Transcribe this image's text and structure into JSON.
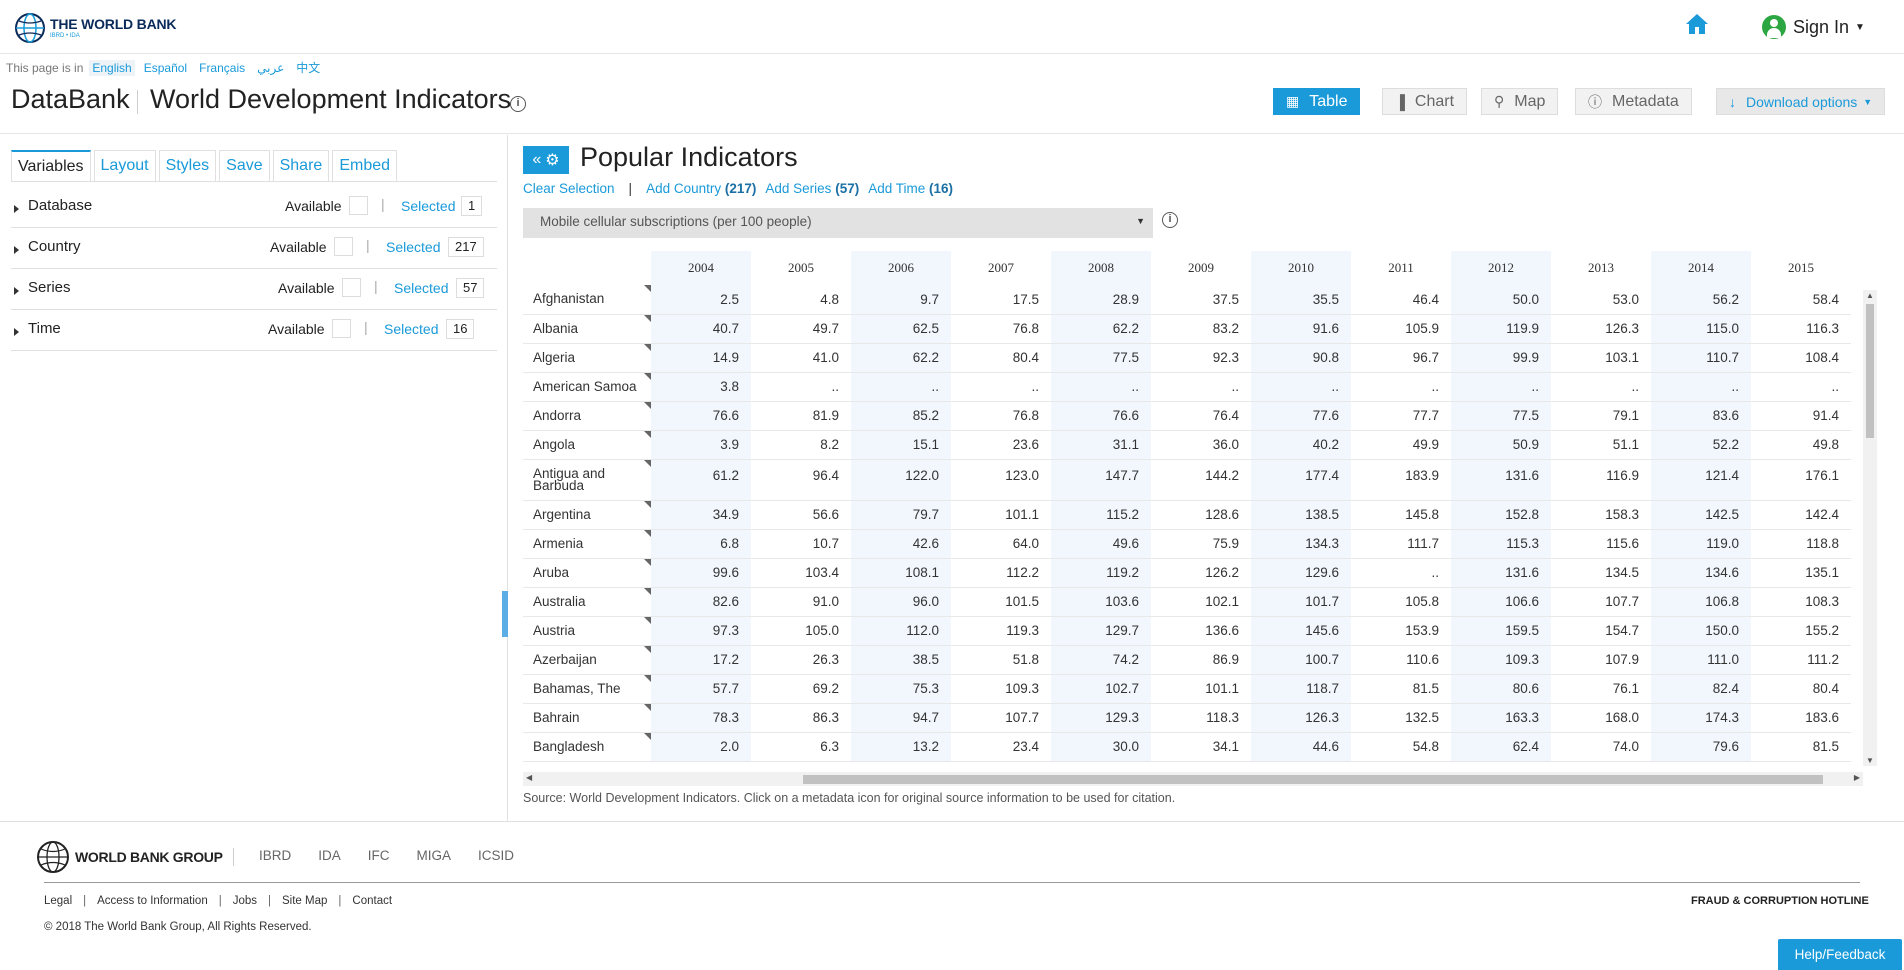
{
  "header": {
    "logo_title": "THE WORLD BANK",
    "logo_sub": "IBRD • IDA",
    "home_icon": "home-icon",
    "signin_label": "Sign In"
  },
  "language": {
    "prefix": "This page is in",
    "options": [
      "English",
      "Español",
      "Français",
      "عربي",
      "中文"
    ],
    "active": "English"
  },
  "title": {
    "app": "DataBank",
    "database": "World Development Indicators"
  },
  "views": {
    "table": "Table",
    "chart": "Chart",
    "map": "Map",
    "metadata": "Metadata",
    "download": "Download options"
  },
  "left_panel": {
    "tabs": [
      "Variables",
      "Layout",
      "Styles",
      "Save",
      "Share",
      "Embed"
    ],
    "active_tab": "Variables",
    "available_label": "Available",
    "selected_label": "Selected",
    "variables": [
      {
        "name": "Database",
        "selected": "1"
      },
      {
        "name": "Country",
        "selected": "217"
      },
      {
        "name": "Series",
        "selected": "57"
      },
      {
        "name": "Time",
        "selected": "16"
      }
    ]
  },
  "main": {
    "title": "Popular Indicators",
    "clear_selection": "Clear Selection",
    "add_country": "Add Country",
    "add_country_count": "(217)",
    "add_series": "Add Series",
    "add_series_count": "(57)",
    "add_time": "Add Time",
    "add_time_count": "(16)",
    "series_selected": "Mobile cellular subscriptions (per 100 people)",
    "source": "Source: World Development Indicators. Click on a metadata icon for original source information to be used for citation."
  },
  "table": {
    "years": [
      "2004",
      "2005",
      "2006",
      "2007",
      "2008",
      "2009",
      "2010",
      "2011",
      "2012",
      "2013",
      "2014",
      "2015"
    ],
    "rows": [
      {
        "country": "Afghanistan",
        "values": [
          "2.5",
          "4.8",
          "9.7",
          "17.5",
          "28.9",
          "37.5",
          "35.5",
          "46.4",
          "50.0",
          "53.0",
          "56.2",
          "58.4"
        ]
      },
      {
        "country": "Albania",
        "values": [
          "40.7",
          "49.7",
          "62.5",
          "76.8",
          "62.2",
          "83.2",
          "91.6",
          "105.9",
          "119.9",
          "126.3",
          "115.0",
          "116.3"
        ]
      },
      {
        "country": "Algeria",
        "values": [
          "14.9",
          "41.0",
          "62.2",
          "80.4",
          "77.5",
          "92.3",
          "90.8",
          "96.7",
          "99.9",
          "103.1",
          "110.7",
          "108.4"
        ]
      },
      {
        "country": "American Samoa",
        "values": [
          "3.8",
          "..",
          "..",
          "..",
          "..",
          "..",
          "..",
          "..",
          "..",
          "..",
          "..",
          ".."
        ]
      },
      {
        "country": "Andorra",
        "values": [
          "76.6",
          "81.9",
          "85.2",
          "76.8",
          "76.6",
          "76.4",
          "77.6",
          "77.7",
          "77.5",
          "79.1",
          "83.6",
          "91.4"
        ]
      },
      {
        "country": "Angola",
        "values": [
          "3.9",
          "8.2",
          "15.1",
          "23.6",
          "31.1",
          "36.0",
          "40.2",
          "49.9",
          "50.9",
          "51.1",
          "52.2",
          "49.8"
        ]
      },
      {
        "country": "Antigua and Barbuda",
        "values": [
          "61.2",
          "96.4",
          "122.0",
          "123.0",
          "147.7",
          "144.2",
          "177.4",
          "183.9",
          "131.6",
          "116.9",
          "121.4",
          "176.1"
        ]
      },
      {
        "country": "Argentina",
        "values": [
          "34.9",
          "56.6",
          "79.7",
          "101.1",
          "115.2",
          "128.6",
          "138.5",
          "145.8",
          "152.8",
          "158.3",
          "142.5",
          "142.4"
        ]
      },
      {
        "country": "Armenia",
        "values": [
          "6.8",
          "10.7",
          "42.6",
          "64.0",
          "49.6",
          "75.9",
          "134.3",
          "111.7",
          "115.3",
          "115.6",
          "119.0",
          "118.8"
        ]
      },
      {
        "country": "Aruba",
        "values": [
          "99.6",
          "103.4",
          "108.1",
          "112.2",
          "119.2",
          "126.2",
          "129.6",
          "..",
          "131.6",
          "134.5",
          "134.6",
          "135.1"
        ]
      },
      {
        "country": "Australia",
        "values": [
          "82.6",
          "91.0",
          "96.0",
          "101.5",
          "103.6",
          "102.1",
          "101.7",
          "105.8",
          "106.6",
          "107.7",
          "106.8",
          "108.3"
        ]
      },
      {
        "country": "Austria",
        "values": [
          "97.3",
          "105.0",
          "112.0",
          "119.3",
          "129.7",
          "136.6",
          "145.6",
          "153.9",
          "159.5",
          "154.7",
          "150.0",
          "155.2"
        ]
      },
      {
        "country": "Azerbaijan",
        "values": [
          "17.2",
          "26.3",
          "38.5",
          "51.8",
          "74.2",
          "86.9",
          "100.7",
          "110.6",
          "109.3",
          "107.9",
          "111.0",
          "111.2"
        ]
      },
      {
        "country": "Bahamas, The",
        "values": [
          "57.7",
          "69.2",
          "75.3",
          "109.3",
          "102.7",
          "101.1",
          "118.7",
          "81.5",
          "80.6",
          "76.1",
          "82.4",
          "80.4"
        ]
      },
      {
        "country": "Bahrain",
        "values": [
          "78.3",
          "86.3",
          "94.7",
          "107.7",
          "129.3",
          "118.3",
          "126.3",
          "132.5",
          "163.3",
          "168.0",
          "174.3",
          "183.6"
        ]
      },
      {
        "country": "Bangladesh",
        "values": [
          "2.0",
          "6.3",
          "13.2",
          "23.4",
          "30.0",
          "34.1",
          "44.6",
          "54.8",
          "62.4",
          "74.0",
          "79.6",
          "81.5"
        ]
      }
    ]
  },
  "footer": {
    "group_name": "WORLD BANK GROUP",
    "orgs": [
      "IBRD",
      "IDA",
      "IFC",
      "MIGA",
      "ICSID"
    ],
    "links": [
      "Legal",
      "Access to Information",
      "Jobs",
      "Site Map",
      "Contact"
    ],
    "hotline": "FRAUD & CORRUPTION HOTLINE",
    "copyright": "© 2018 The World Bank Group, All Rights Reserved.",
    "help": "Help/Feedback"
  },
  "colors": {
    "accent": "#1a9ad9",
    "column_shade": "#f1f7fd",
    "signin_avatar": "#2ca641"
  }
}
